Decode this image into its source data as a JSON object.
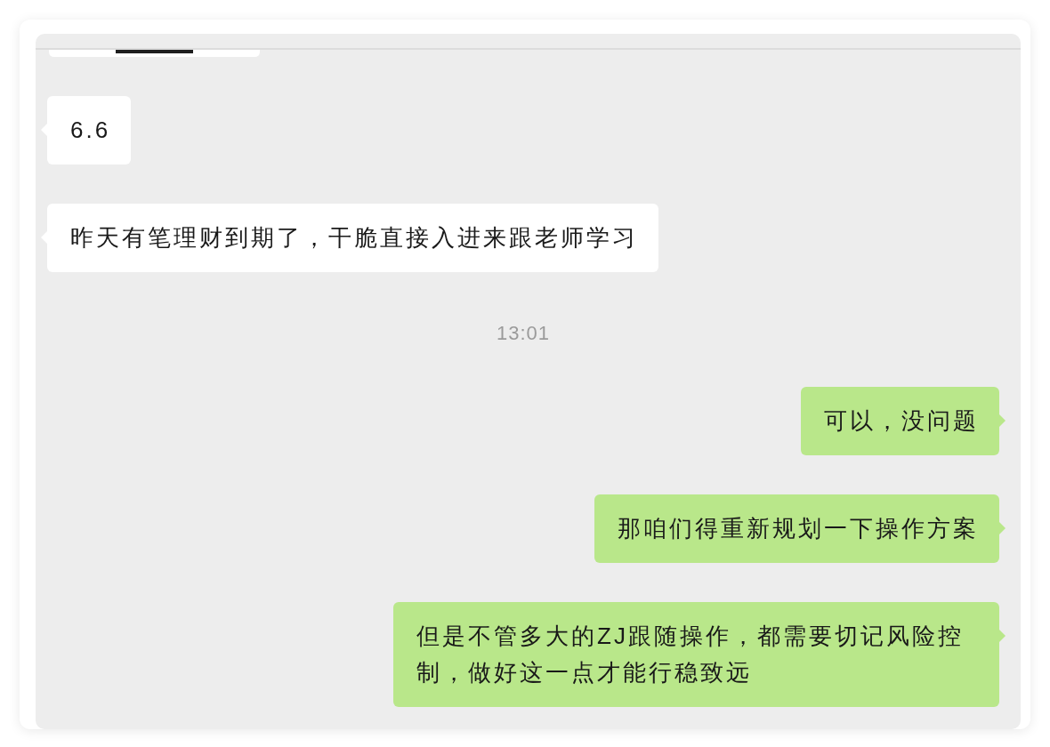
{
  "chat": {
    "messages": [
      {
        "kind": "partial"
      },
      {
        "kind": "received",
        "text": "6.6"
      },
      {
        "kind": "received",
        "text": "昨天有笔理财到期了，干脆直接入进来跟老师学习"
      },
      {
        "kind": "time",
        "text": "13:01"
      },
      {
        "kind": "sent",
        "text": "可以，没问题"
      },
      {
        "kind": "sent",
        "text": "那咱们得重新规划一下操作方案"
      },
      {
        "kind": "sent",
        "text": "但是不管多大的ZJ跟随操作，都需要切记风险控制，做好这一点才能行稳致远"
      }
    ]
  }
}
